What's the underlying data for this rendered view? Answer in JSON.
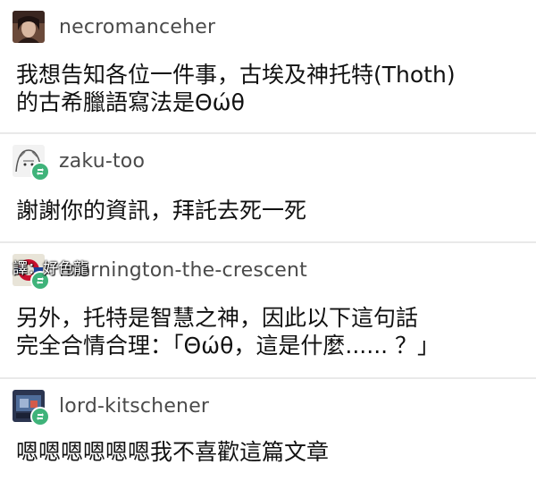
{
  "posts": [
    {
      "username": "necromanceher",
      "body": "我想告知各位一件事，古埃及神托特(Thoth)\n的古希臘語寫法是Θώθ"
    },
    {
      "username": "zaku-too",
      "body": "謝謝你的資訊，拜託去死一死"
    },
    {
      "username": "mornington-the-crescent",
      "body": "另外，托特是智慧之神，因此以下這句話\n完全合情合理：「Θώθ，這是什麼...... ？」"
    },
    {
      "username": "lord-kitschener",
      "body": "嗯嗯嗯嗯嗯嗯我不喜歡這篇文章"
    }
  ],
  "watermark": "譯：好色龍",
  "colors": {
    "reblog_badge": "#3fb37a",
    "post_background": "#ffffff",
    "separator": "#e9e9e9"
  },
  "icons": [
    "reblog-icon"
  ]
}
